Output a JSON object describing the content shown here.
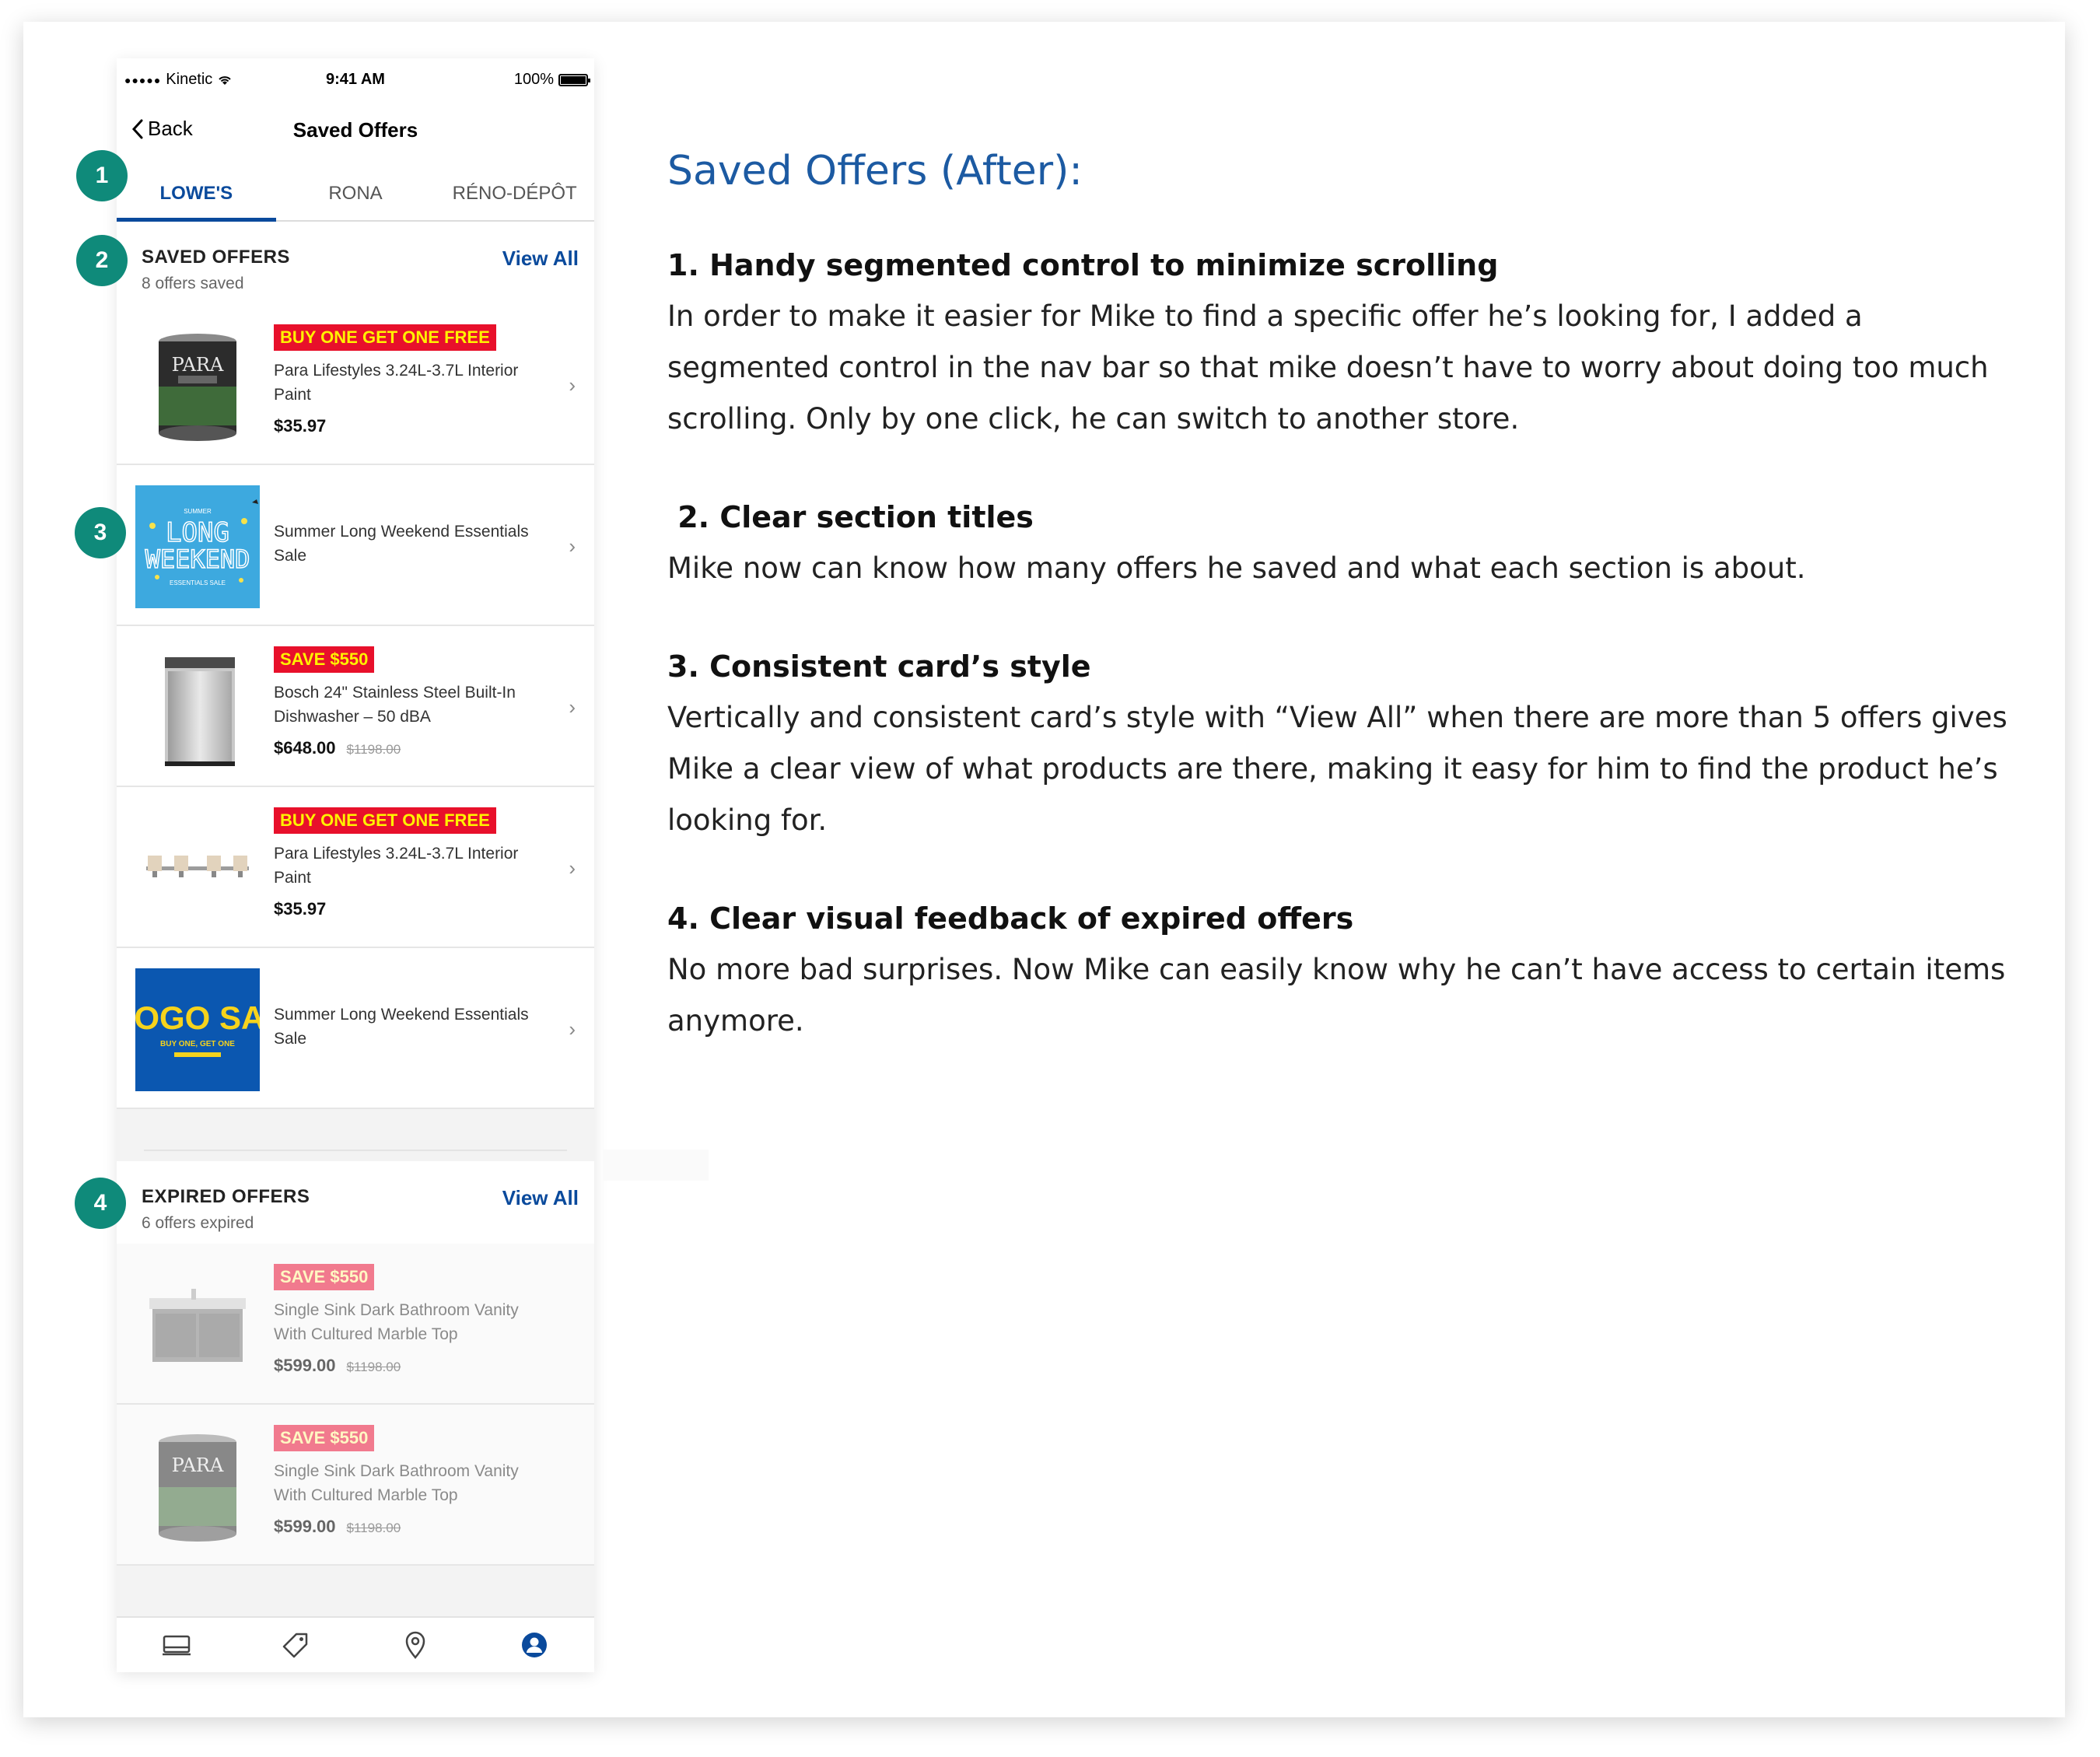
{
  "status_bar": {
    "carrier": "Kinetic",
    "time": "9:41 AM",
    "battery": "100%"
  },
  "nav": {
    "back_label": "Back",
    "title": "Saved Offers"
  },
  "segments": [
    {
      "label": "LOWE'S",
      "active": true
    },
    {
      "label": "RONA",
      "active": false
    },
    {
      "label": "RÉNO-DÉPÔT",
      "active": false
    }
  ],
  "saved_section": {
    "title": "SAVED OFFERS",
    "subtitle": "8 offers saved",
    "link": "View All"
  },
  "saved_offers": [
    {
      "badge": "BUY ONE GET ONE FREE",
      "name": "Para Lifestyles 3.24L-3.7L Interior Paint",
      "price": "$35.97",
      "old_price": "",
      "image": "paint-can"
    },
    {
      "badge": "",
      "name": "Summer Long Weekend Essentials Sale",
      "price": "",
      "old_price": "",
      "image": "long-weekend-banner",
      "banner_text": {
        "small": "SUMMER",
        "line1": "LONG",
        "line2": "WEEKEND",
        "foot": "ESSENTIALS SALE"
      }
    },
    {
      "badge": "SAVE $550",
      "name": "Bosch 24\" Stainless Steel Built-In Dishwasher – 50 dBA",
      "price": "$648.00",
      "old_price": "$1198.00",
      "image": "dishwasher"
    },
    {
      "badge": "BUY ONE GET ONE FREE",
      "name": "Para Lifestyles 3.24L-3.7L Interior Paint",
      "price": "$35.97",
      "old_price": "",
      "image": "vanity-light"
    },
    {
      "badge": "",
      "name": "Summer Long Weekend Essentials Sale",
      "price": "",
      "old_price": "",
      "image": "bogo-sale-banner",
      "banner_text": {
        "big": "BOGO SAL",
        "sub": "BUY ONE, GET ONE"
      }
    }
  ],
  "expired_section": {
    "title": "EXPIRED OFFERS",
    "subtitle": "6 offers expired",
    "link": "View All"
  },
  "expired_offers": [
    {
      "badge": "SAVE $550",
      "name": "Single Sink Dark Bathroom Vanity With Cultured Marble Top",
      "price": "$599.00",
      "old_price": "$1198.00",
      "image": "bathroom-vanity"
    },
    {
      "badge": "SAVE $550",
      "name": "Single Sink Dark Bathroom Vanity With Cultured Marble Top",
      "price": "$599.00",
      "old_price": "$1198.00",
      "image": "paint-can"
    }
  ],
  "tab_bar": [
    {
      "icon": "store-icon",
      "active": false
    },
    {
      "icon": "tag-icon",
      "active": false
    },
    {
      "icon": "location-pin-icon",
      "active": false
    },
    {
      "icon": "account-icon",
      "active": true
    }
  ],
  "callouts": [
    "1",
    "2",
    "3",
    "4"
  ],
  "colors": {
    "brand_blue": "#0a4a9c",
    "heading_blue": "#1c5aa2",
    "callout_teal": "#0f8a7a",
    "badge_red": "#e8102b",
    "badge_yellow": "#fff200",
    "expired_badge": "#f17a8e"
  },
  "copy": {
    "heading": "Saved Offers (After):",
    "points": [
      {
        "title": "1. Handy segmented control to minimize scrolling",
        "body": "In order to make it easier for Mike to find a specific offer he’s looking for, I added a segmented control in the nav bar so that mike doesn’t have to worry about doing too much scrolling. Only by one click, he can switch to another store."
      },
      {
        "title": " 2. Clear section titles",
        "body": "Mike now can know how many offers he saved and what each section is about."
      },
      {
        "title": "3. Consistent card’s style",
        "body": "Vertically and consistent card’s style with “View All” when there are more than 5 offers gives Mike a clear view of what products are there, making it easy for him to find the product he’s looking for."
      },
      {
        "title": "4. Clear visual feedback of expired offers",
        "body": "No more bad surprises. Now Mike can easily know why he can’t have access to certain items anymore."
      }
    ]
  }
}
